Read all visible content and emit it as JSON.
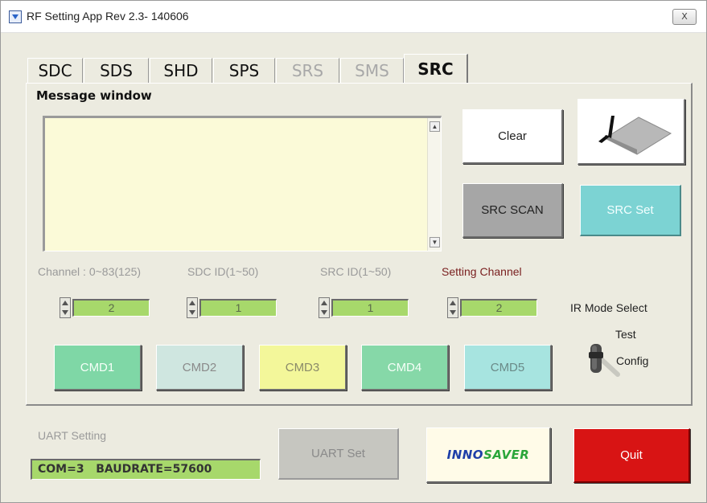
{
  "window": {
    "title": "RF Setting App Rev 2.3- 140606",
    "close_label": "X"
  },
  "tabs": [
    {
      "label": "SDC",
      "state": "normal"
    },
    {
      "label": "SDS",
      "state": "normal"
    },
    {
      "label": "SHD",
      "state": "normal"
    },
    {
      "label": "SPS",
      "state": "normal"
    },
    {
      "label": "SRS",
      "state": "disabled"
    },
    {
      "label": "SMS",
      "state": "disabled"
    },
    {
      "label": "SRC",
      "state": "active"
    }
  ],
  "message": {
    "title": "Message window",
    "text": "",
    "scroll_up": "▲",
    "scroll_down": "▼"
  },
  "buttons": {
    "clear": "Clear",
    "src_scan": "SRC SCAN",
    "src_set": "SRC Set",
    "cmd": [
      "CMD1",
      "CMD2",
      "CMD3",
      "CMD4",
      "CMD5"
    ],
    "uart_set": "UART Set",
    "quit": "Quit"
  },
  "fields": {
    "channel_label": "Channel : 0~83(125)",
    "sdc_id_label": "SDC ID(1~50)",
    "src_id_label": "SRC ID(1~50)",
    "setting_channel_label": "Setting Channel",
    "channel_value": "2",
    "sdc_id_value": "1",
    "src_id_value": "1",
    "setting_channel_value": "2"
  },
  "ir_mode": {
    "label": "IR Mode Select",
    "option_top": "Test",
    "option_bottom": "Config",
    "selected": "Config"
  },
  "uart": {
    "label": "UART Setting",
    "status": "COM=3   BAUDRATE=57600"
  },
  "logo": {
    "left": "INNO",
    "right": "SAVER"
  },
  "colors": {
    "panel_bg": "#ecebe0",
    "message_bg": "#fbfad8",
    "spinner_bg": "#a7d86b",
    "clear_bg": "#ffffff",
    "src_scan_bg": "#a6a6a6",
    "src_set_bg": "#7cd3d3",
    "cmd1_bg": "#7fd7a6",
    "cmd2_bg": "#cfe6e0",
    "cmd3_bg": "#f3f79a",
    "cmd4_bg": "#86d8a8",
    "cmd5_bg": "#a7e4e0",
    "uart_set_bg": "#c6c6c0",
    "quit_bg": "#d81414",
    "setting_channel_text": "#7a2020",
    "logo_blue": "#1e3fa8",
    "logo_green": "#2aa63a"
  }
}
